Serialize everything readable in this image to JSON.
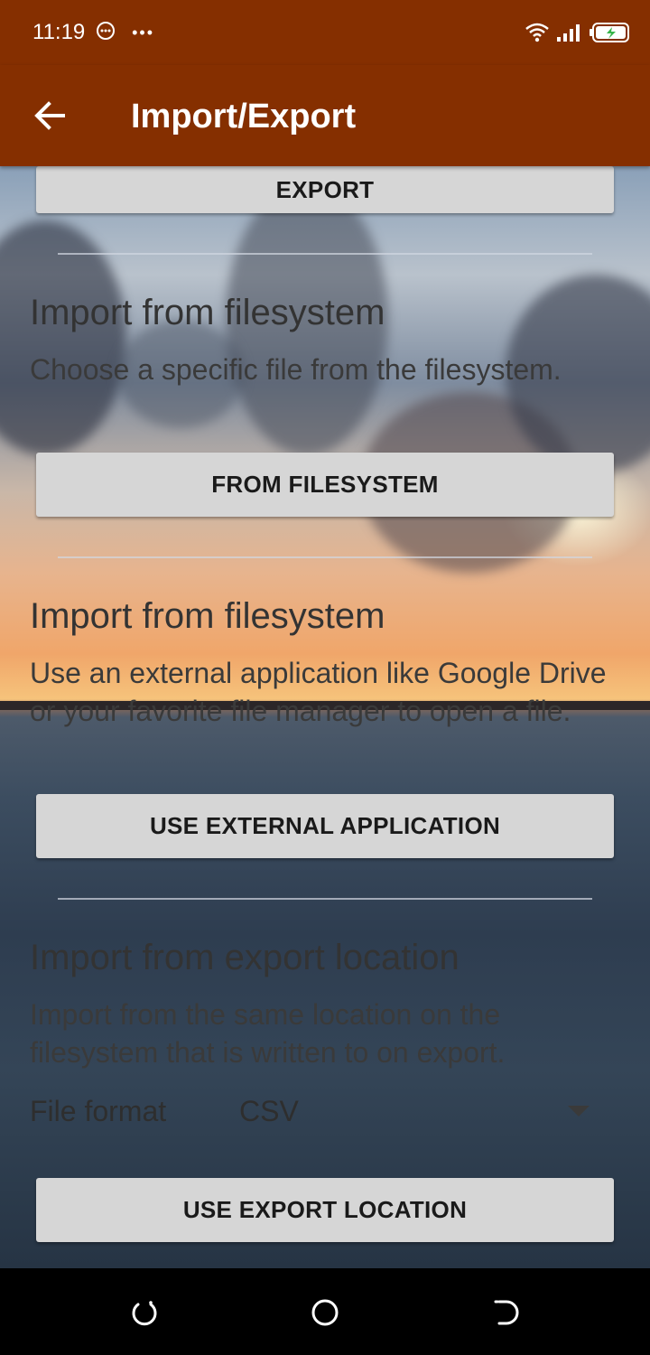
{
  "status_bar": {
    "time": "11:19",
    "left_icons": [
      "notification-icon",
      "more-dots-icon"
    ],
    "more_text": "•••",
    "right_icons": [
      "wifi-icon",
      "signal-icon",
      "battery-icon"
    ]
  },
  "app_bar": {
    "title": "Import/Export",
    "back_icon": "arrow-back-icon",
    "color": "#852f00"
  },
  "export_section": {
    "button_label": "EXPORT"
  },
  "sections": [
    {
      "title": "Import from filesystem",
      "description": "Choose a specific file from the filesystem.",
      "button_label": "FROM FILESYSTEM"
    },
    {
      "title": "Import from filesystem",
      "description": "Use an external application like Google Drive or your favorite file manager to open a file.",
      "button_label": "USE EXTERNAL APPLICATION"
    },
    {
      "title": "Import from export location",
      "description": "Import from the same location on the filesystem that is written to on export.",
      "button_label": "USE EXPORT LOCATION"
    }
  ],
  "file_format": {
    "label": "File format",
    "value": "CSV"
  },
  "nav_bar": {
    "icons": [
      "recent-apps-icon",
      "home-icon",
      "back-nav-icon"
    ]
  }
}
